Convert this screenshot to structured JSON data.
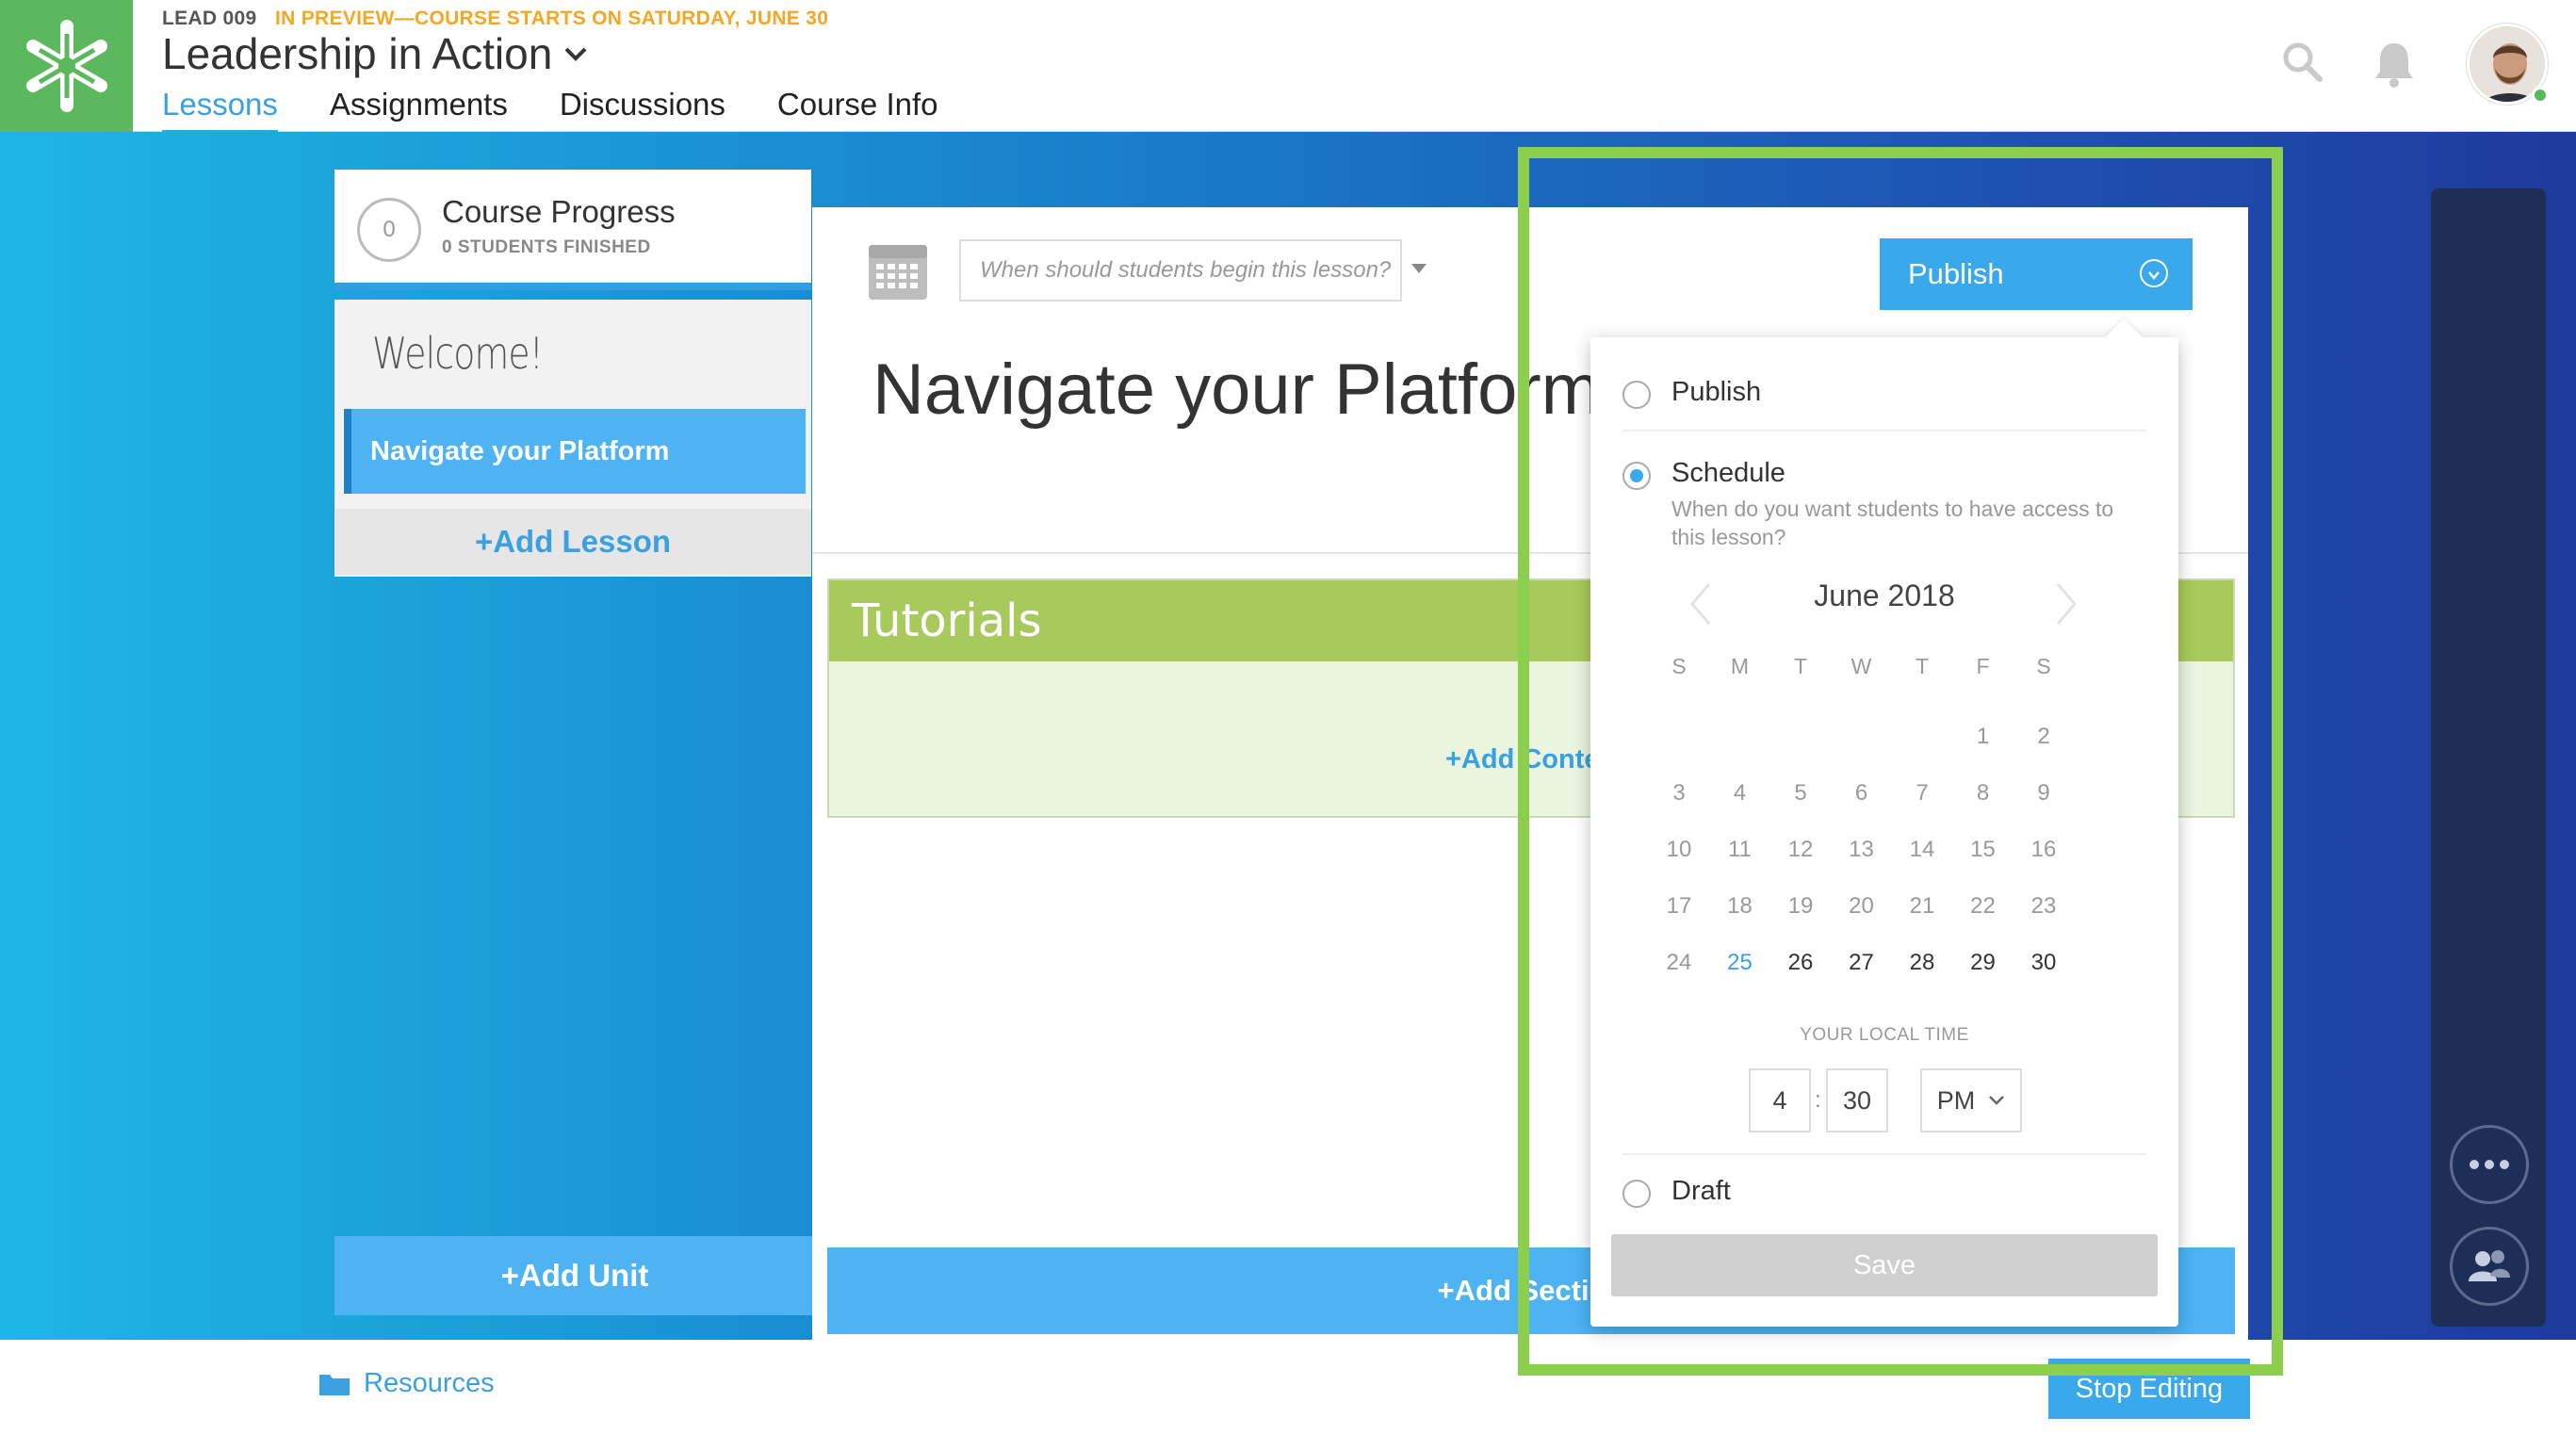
{
  "header": {
    "course_code": "LEAD 009",
    "preview_notice": "IN PREVIEW—COURSE STARTS ON SATURDAY, JUNE 30",
    "course_title": "Leadership in Action",
    "tabs": [
      {
        "label": "Lessons",
        "active": true
      },
      {
        "label": "Assignments",
        "active": false
      },
      {
        "label": "Discussions",
        "active": false
      },
      {
        "label": "Course Info",
        "active": false
      }
    ],
    "icons": [
      "search-icon",
      "bell-icon",
      "avatar"
    ]
  },
  "sidebar": {
    "progress_count": "0",
    "progress_title": "Course Progress",
    "progress_sub": "0 STUDENTS FINISHED",
    "unit_title": "Welcome!",
    "lessons": [
      {
        "label": "Navigate your Platform",
        "active": true
      }
    ],
    "add_lesson": "+Add Lesson",
    "add_unit": "+Add Unit"
  },
  "main": {
    "date_placeholder": "When should students begin this lesson?",
    "lesson_title": "Navigate your Platform",
    "publish_button": "Publish",
    "section_title": "Tutorials",
    "add_content": "+Add Content",
    "add_section": "+Add Section"
  },
  "publish_menu": {
    "options": {
      "publish": "Publish",
      "schedule": "Schedule",
      "schedule_desc": "When do you want students to have access to this lesson?",
      "draft": "Draft"
    },
    "selected": "schedule",
    "calendar": {
      "month": "June 2018",
      "weekdays": [
        "S",
        "M",
        "T",
        "W",
        "T",
        "F",
        "S"
      ],
      "today": 25,
      "first_selectable": 25
    },
    "local_time_label": "YOUR LOCAL TIME",
    "hour": "4",
    "minute": "30",
    "meridiem": "PM",
    "save": "Save"
  },
  "footer": {
    "resources": "Resources",
    "stop_editing": "Stop Editing"
  },
  "colors": {
    "brand_green": "#5cb85c",
    "accent_blue": "#3aa9ec",
    "section_green": "#a8c95b",
    "highlight_green": "#8ccf4d",
    "preview_orange": "#f5a623"
  }
}
